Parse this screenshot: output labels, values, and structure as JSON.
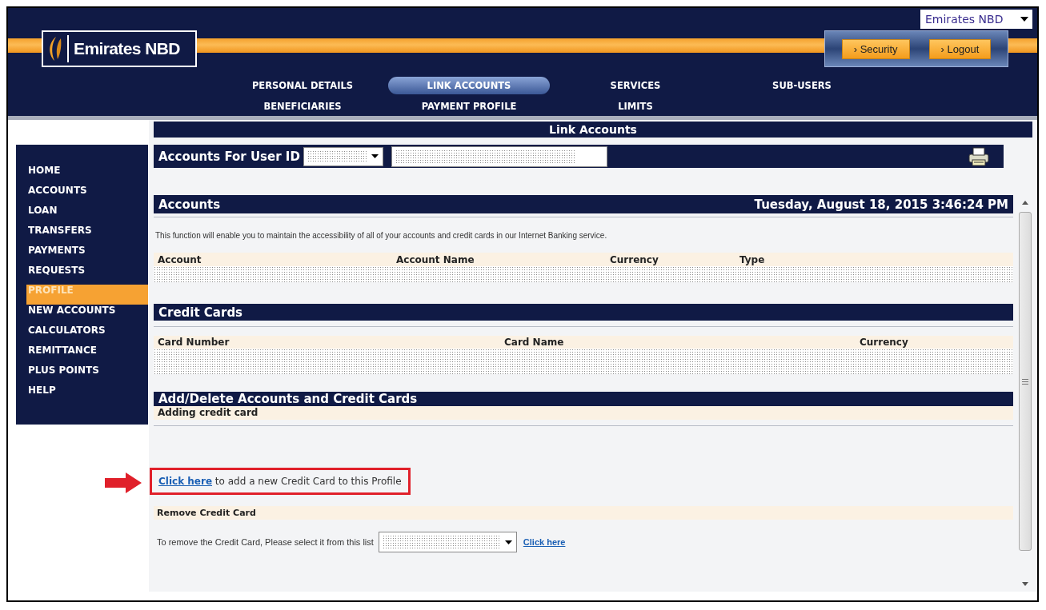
{
  "logo": {
    "text": "Emirates NBD"
  },
  "language_select": {
    "value": "Emirates NBD"
  },
  "header_buttons": [
    "› Security",
    "› Logout"
  ],
  "tabs": [
    {
      "label": "PERSONAL DETAILS",
      "selected": false
    },
    {
      "label": "LINK ACCOUNTS",
      "selected": true
    },
    {
      "label": "SERVICES",
      "selected": false
    },
    {
      "label": "SUB-USERS",
      "selected": false
    },
    {
      "label": "BENEFICIARIES",
      "selected": false
    },
    {
      "label": "PAYMENT PROFILE",
      "selected": false
    },
    {
      "label": "LIMITS",
      "selected": false
    }
  ],
  "sidebar": {
    "items": [
      {
        "label": "HOME",
        "selected": false
      },
      {
        "label": "ACCOUNTS",
        "selected": false
      },
      {
        "label": "LOAN",
        "selected": false
      },
      {
        "label": "TRANSFERS",
        "selected": false
      },
      {
        "label": "PAYMENTS",
        "selected": false
      },
      {
        "label": "REQUESTS",
        "selected": false
      },
      {
        "label": "PROFILE",
        "selected": true
      },
      {
        "label": "NEW ACCOUNTS",
        "selected": false
      },
      {
        "label": "CALCULATORS",
        "selected": false
      },
      {
        "label": "REMITTANCE",
        "selected": false
      },
      {
        "label": "PLUS POINTS",
        "selected": false
      },
      {
        "label": "HELP",
        "selected": false
      }
    ]
  },
  "page_title": "Link Accounts",
  "user_id_bar": {
    "label": "Accounts For User ID"
  },
  "accounts": {
    "title": "Accounts",
    "timestamp": "Tuesday, August 18, 2015 3:46:24 PM",
    "description": "This function will enable you to maintain the accessibility of all of your accounts and credit cards in our Internet Banking service.",
    "columns": [
      "Account",
      "Account Name",
      "Currency",
      "Type"
    ]
  },
  "credit_cards": {
    "title": "Credit Cards",
    "columns": [
      "Card Number",
      "Card Name",
      "Currency"
    ]
  },
  "add_delete": {
    "title": "Add/Delete Accounts and Credit Cards",
    "subtitle": "Adding credit card",
    "add_link": "Click here",
    "add_text": " to add a new Credit Card to this Profile",
    "remove_title": "Remove Credit Card",
    "remove_text": "To remove the Credit Card, Please select it from this list",
    "remove_link": "Click here"
  }
}
